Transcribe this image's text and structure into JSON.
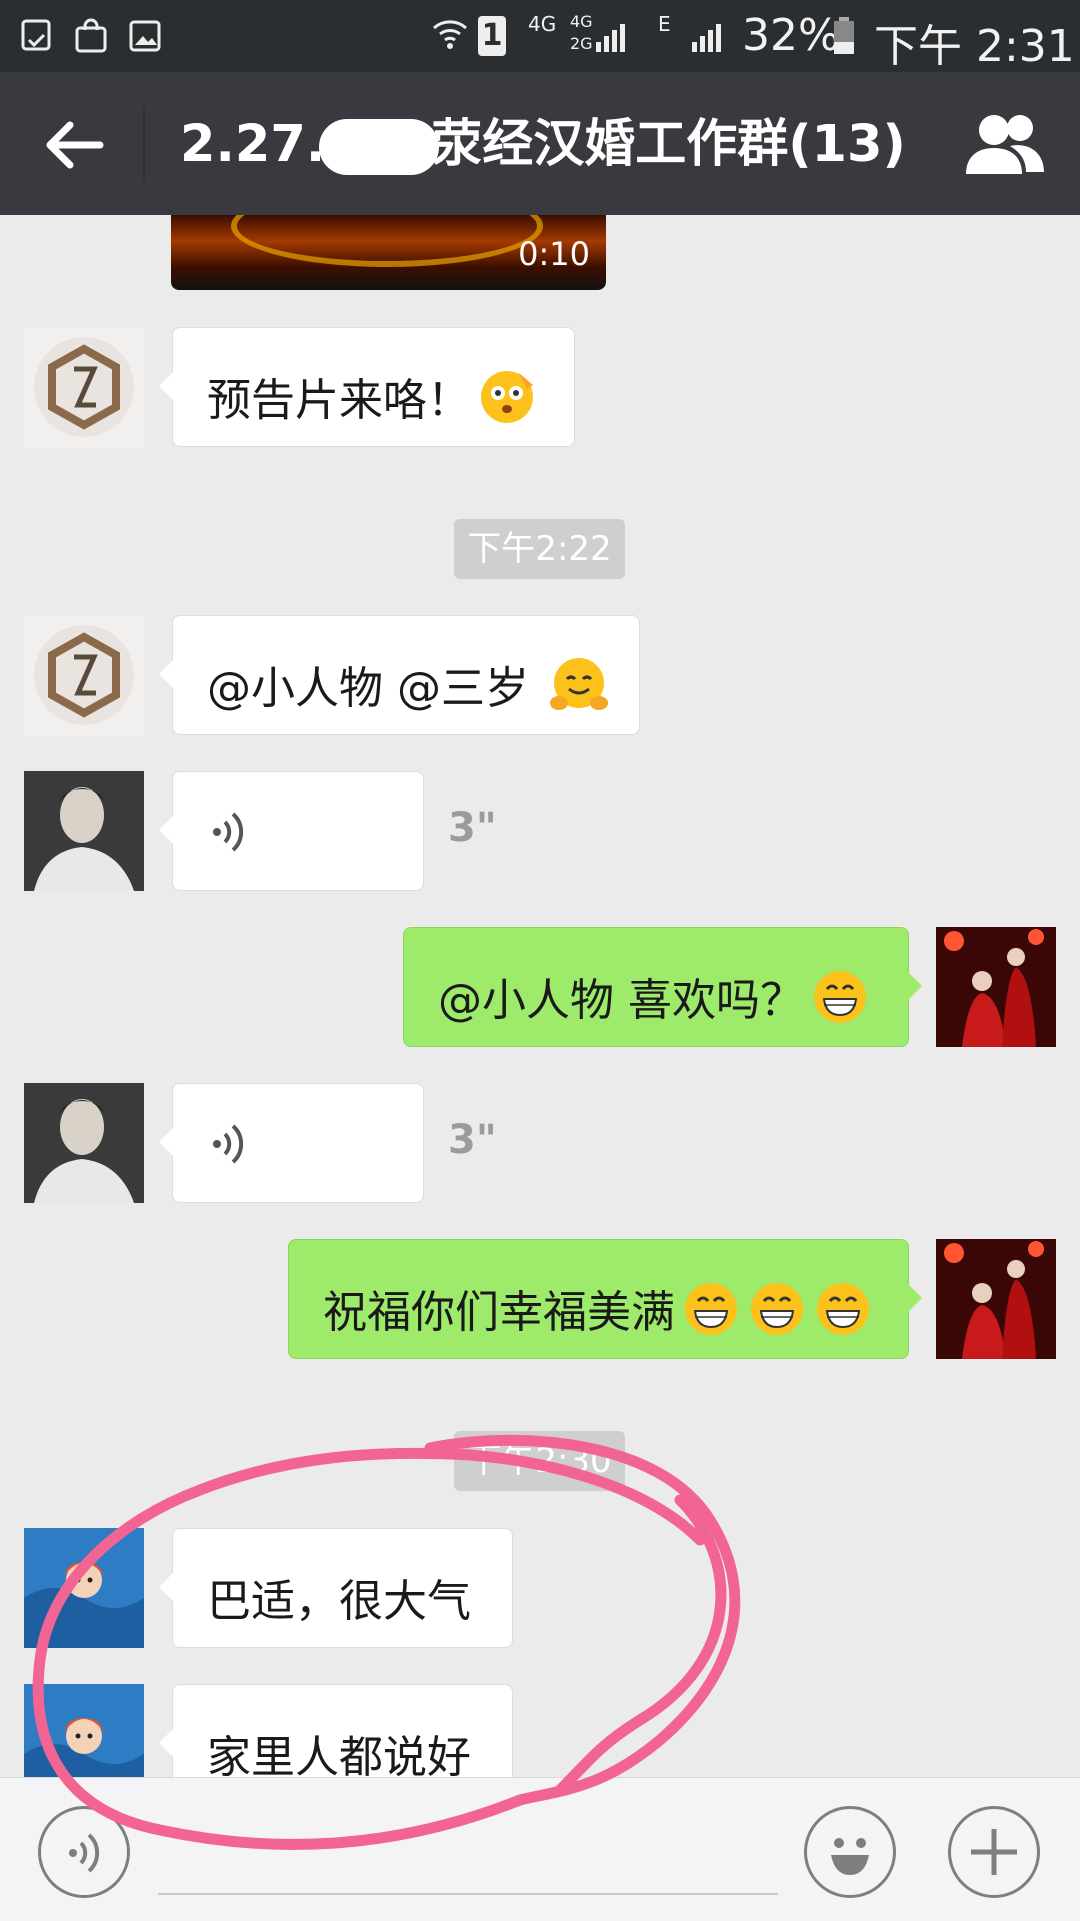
{
  "status_bar": {
    "battery": "32%",
    "time": "下午 2:31",
    "sim_badge": "1",
    "network_4g": "4G",
    "network_4g2g_top": "4G",
    "network_4g2g_bottom": "2G",
    "network_e": "E"
  },
  "header": {
    "title_prefix": "2.27.",
    "title_suffix": "荥经汉婚工作群(13)"
  },
  "messages": {
    "video_duration": "0:10",
    "m1_text": "预告片来咯！",
    "time_1": "下午2:22",
    "m2_text": "@小人物 @三岁 ",
    "voice_1_duration": "3\"",
    "m3_text": "@小人物 喜欢吗？",
    "voice_2_duration": "3\"",
    "m4_text": "祝福你们幸福美满",
    "time_2": "下午2:30",
    "m5_text": "巴适，很大气",
    "m6_text": "家里人都说好"
  },
  "icons": {
    "back": "back-arrow-icon",
    "members": "group-members-icon",
    "voice": "voice-wave-icon",
    "emoji": "emoji-face-icon",
    "plus": "plus-icon"
  },
  "colors": {
    "titlebar": "#393a3f",
    "statusbar": "#2b2e31",
    "chat_bg": "#ebebeb",
    "sent_bubble": "#9eea6a",
    "received_bubble": "#ffffff",
    "annotation_scribble": "#f26592"
  }
}
